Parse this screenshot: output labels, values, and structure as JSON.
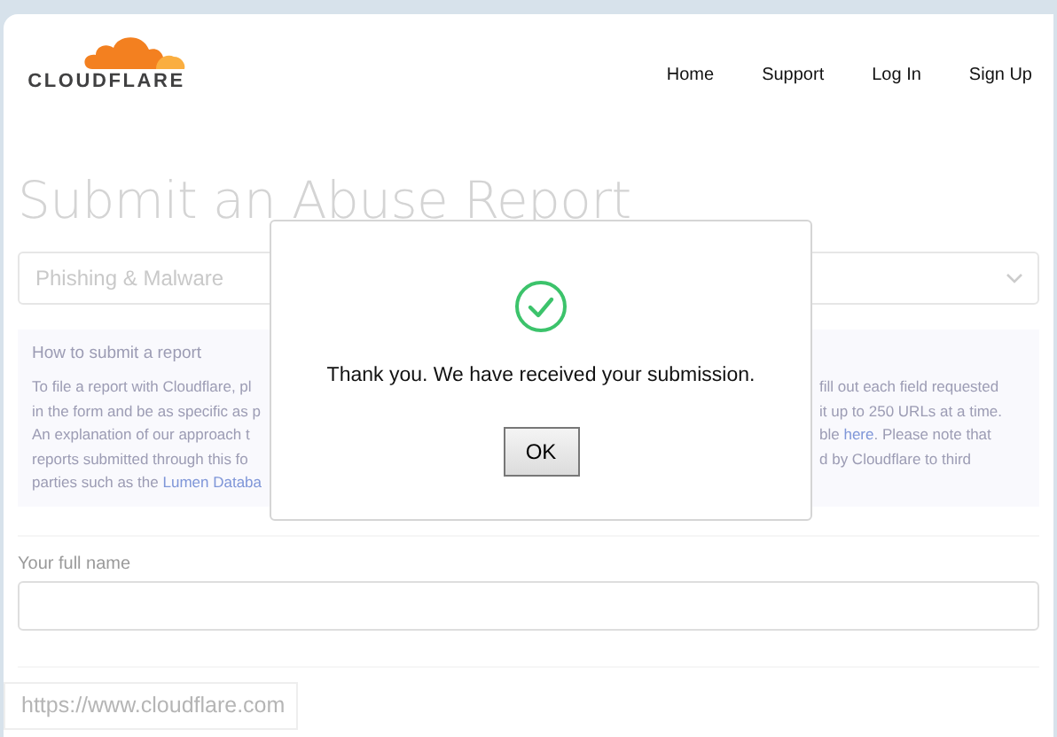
{
  "header": {
    "logo_text": "CLOUDFLARE",
    "nav": [
      "Home",
      "Support",
      "Log In",
      "Sign Up"
    ]
  },
  "page": {
    "title": "Submit an Abuse Report",
    "report_type": {
      "value": "Phishing & Malware"
    },
    "info": {
      "heading": "How to submit a report",
      "left_lines": [
        [
          {
            "kind": "text",
            "text": "To file a report with Cloudflare, pl"
          }
        ],
        [
          {
            "kind": "text",
            "text": "in the form and be as specific as p"
          }
        ],
        [
          {
            "kind": "text",
            "text": "An explanation of our approach t"
          }
        ],
        [
          {
            "kind": "text",
            "text": "reports submitted through this fo"
          }
        ],
        [
          {
            "kind": "text",
            "text": "parties such as the"
          },
          {
            "kind": "link",
            "text": "Lumen Databa"
          }
        ]
      ],
      "right_lines": [
        [
          {
            "kind": "text",
            "text": "fill out each field requested"
          }
        ],
        [
          {
            "kind": "text",
            "text": "it up to 250 URLs at a time."
          }
        ],
        [
          {
            "kind": "text",
            "text": "ble"
          },
          {
            "kind": "link",
            "text": "here"
          },
          {
            "kind": "text",
            "text": ". Please note that"
          }
        ],
        [
          {
            "kind": "text",
            "text": "d by Cloudflare to third"
          }
        ]
      ]
    },
    "fields": [
      {
        "label": "Your full name"
      }
    ]
  },
  "dialog": {
    "message": "Thank you. We have received your submission.",
    "button": "OK"
  },
  "status_bar": {
    "url": "https://www.cloudflare.com"
  }
}
